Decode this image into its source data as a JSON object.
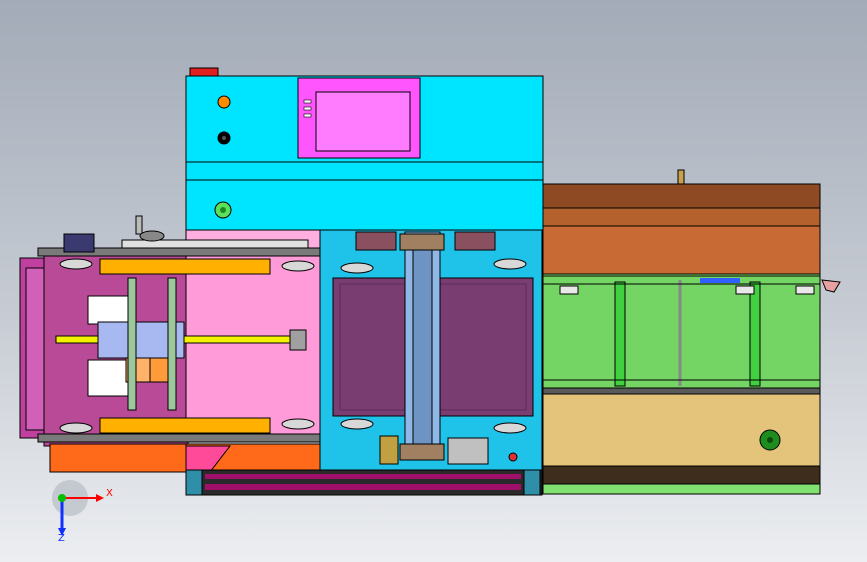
{
  "viewport": {
    "background_top": "#a3abb8",
    "background_bottom": "#eceef1"
  },
  "machine": {
    "control_cabinet": {
      "color": "#00e5ff",
      "hmi_screen_color": "#ff55ff",
      "indicator_lamps": [
        "orange",
        "black",
        "green"
      ]
    },
    "left_carriage": {
      "plate_color": "#ff9bd8",
      "rail_color": "#ffb000",
      "leadscrew_color": "#f2f200"
    },
    "center_conveyor": {
      "frame_color": "#1fc2e8",
      "tray_color": "#7a3d72",
      "column_color": "#8fb8e6"
    },
    "right_module": {
      "frame_color": "#80e070",
      "wood_top_color": "#b5612e",
      "wood_bottom_color": "#e3c47a",
      "bar_color": "#40d040"
    },
    "base_color": "#a0106a"
  },
  "view_triad": {
    "x_label": "X",
    "z_label": "Z",
    "x_color": "#ff0000",
    "y_color": "#00c000",
    "z_color": "#1030ff"
  }
}
